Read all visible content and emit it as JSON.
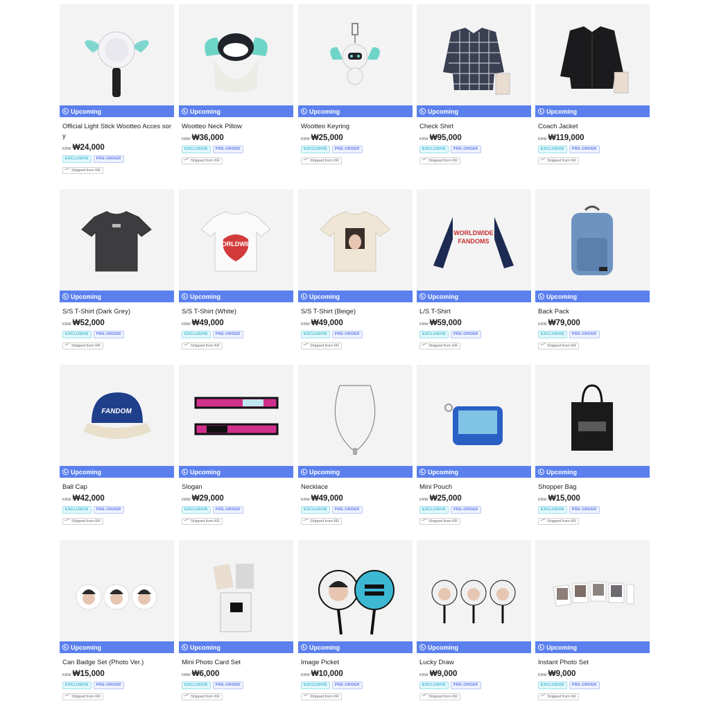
{
  "labels": {
    "upcoming": "Upcoming",
    "currency": "KRW",
    "exclusive": "EXCLUSIVE",
    "preorder": "PRE-ORDER",
    "shipped": "Shipped from KR"
  },
  "colors": {
    "accent": "#5b80ee",
    "exclusive": "#3bb6cf",
    "preorder": "#5b78e8"
  },
  "products": [
    {
      "name": "Official Light Stick Wootteo Acces sory",
      "price": "₩24,000",
      "icon": "light-stick-image"
    },
    {
      "name": "Wootteo Neck Pillow",
      "price": "₩36,000",
      "icon": "neck-pillow-image"
    },
    {
      "name": "Wootteo Keyring",
      "price": "₩25,000",
      "icon": "keyring-image"
    },
    {
      "name": "Check Shirt",
      "price": "₩95,000",
      "icon": "check-shirt-image"
    },
    {
      "name": "Coach Jacket",
      "price": "₩119,000",
      "icon": "coach-jacket-image"
    },
    {
      "name": "S/S T-Shirt (Dark Grey)",
      "price": "₩52,000",
      "icon": "tshirt-dark-grey-image"
    },
    {
      "name": "S/S T-Shirt (White)",
      "price": "₩49,000",
      "icon": "tshirt-white-image"
    },
    {
      "name": "S/S T-Shirt (Beige)",
      "price": "₩49,000",
      "icon": "tshirt-beige-image"
    },
    {
      "name": "L/S T-Shirt",
      "price": "₩59,000",
      "icon": "long-sleeve-tshirt-image"
    },
    {
      "name": "Back Pack",
      "price": "₩79,000",
      "icon": "backpack-image"
    },
    {
      "name": "Ball Cap",
      "price": "₩42,000",
      "icon": "ball-cap-image"
    },
    {
      "name": "Slogan",
      "price": "₩29,000",
      "icon": "slogan-image"
    },
    {
      "name": "Necklace",
      "price": "₩49,000",
      "icon": "necklace-image"
    },
    {
      "name": "Mini Pouch",
      "price": "₩25,000",
      "icon": "mini-pouch-image"
    },
    {
      "name": "Shopper Bag",
      "price": "₩15,000",
      "icon": "shopper-bag-image"
    },
    {
      "name": "Can Badge Set (Photo Ver.)",
      "price": "₩15,000",
      "icon": "can-badge-image"
    },
    {
      "name": "Mini Photo Card Set",
      "price": "₩6,000",
      "icon": "photo-card-image"
    },
    {
      "name": "Image Picket",
      "price": "₩10,000",
      "icon": "image-picket-image"
    },
    {
      "name": "Lucky Draw",
      "price": "₩9,000",
      "icon": "lucky-draw-image"
    },
    {
      "name": "Instant Photo Set",
      "price": "₩9,000",
      "icon": "instant-photo-image"
    }
  ]
}
